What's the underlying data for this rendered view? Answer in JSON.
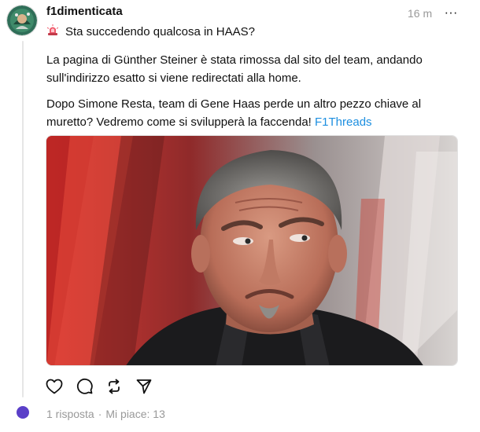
{
  "post": {
    "username": "f1dimenticata",
    "timestamp": "16 m",
    "more_label": "···",
    "headline": "Sta succedendo qualcosa in HAAS?",
    "headline_emoji_icon": "rotating-light-icon",
    "paragraph1": "La pagina di Günther Steiner è stata rimossa dal sito del team, andando sull'indirizzo esatto si viene redirectati alla home.",
    "paragraph2": "Dopo Simone Resta, team di Gene Haas perde un altro pezzo chiave al muretto? Vedremo come si svilupperà la faccenda!",
    "hashtag": "F1Threads",
    "actions": [
      "heart-icon",
      "comment-icon",
      "repost-icon",
      "share-icon"
    ]
  },
  "stats": {
    "replies": "1 risposta",
    "separator": "·",
    "likes": "Mi piace: 13"
  },
  "colors": {
    "accent_link": "#1d8fe0",
    "muted_text": "#999999",
    "reply_dot": "#5a3fc8"
  }
}
